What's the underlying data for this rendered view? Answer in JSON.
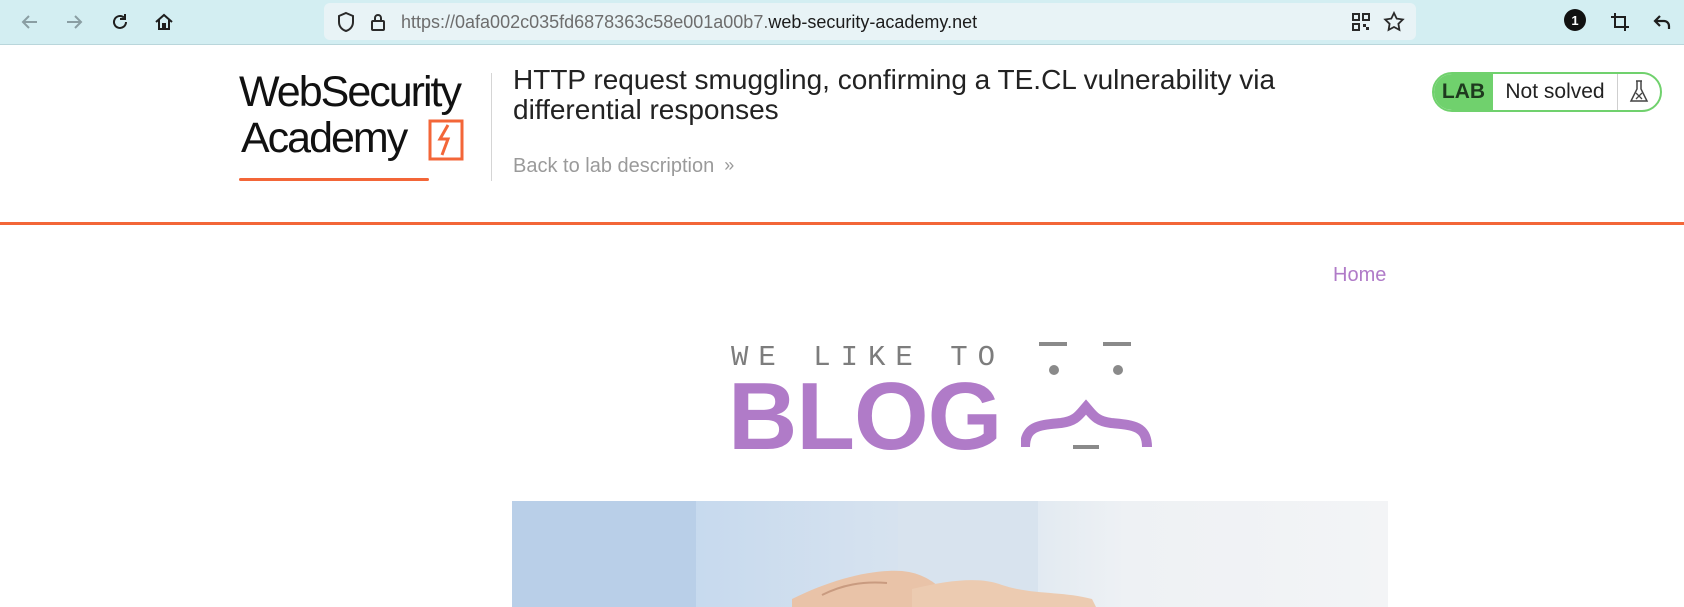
{
  "browser": {
    "url_prefix": "https://0afa002c035fd6878363c58e001a00b7.",
    "url_domain": "web-security-academy.net",
    "notification_count": "1"
  },
  "header": {
    "logo_line1": "WebSecurity",
    "logo_line2": "Academy",
    "lab_title": "HTTP request smuggling, confirming a TE.CL vulnerability via differential responses",
    "back_link": "Back to lab description",
    "lab_tag": "LAB",
    "lab_status": "Not solved",
    "accent_color": "#f36638",
    "status_color": "#70d16d"
  },
  "page": {
    "nav_home": "Home",
    "banner_tagline": "WE LIKE TO",
    "banner_word": "BLOG",
    "brand_color": "#b07bc8"
  }
}
